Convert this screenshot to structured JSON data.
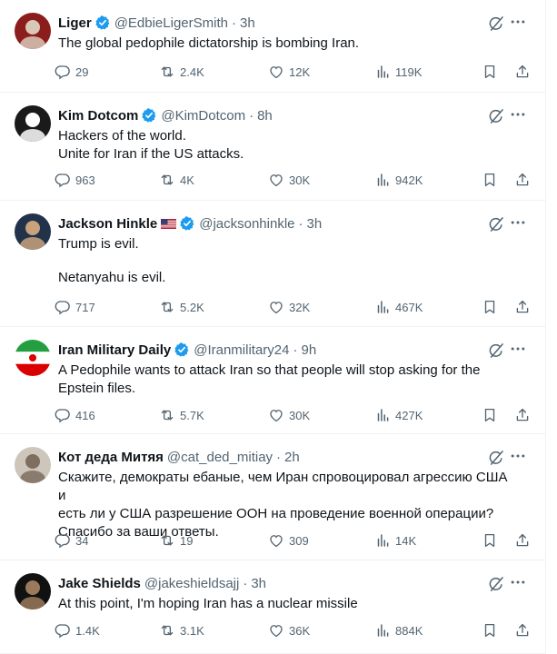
{
  "tweets": [
    {
      "name": "Liger",
      "handle": "@EdbieLigerSmith",
      "time": "3h",
      "verified": true,
      "flag": false,
      "lines": [
        "The global pedophile dictatorship is bombing Iran."
      ],
      "replies": "29",
      "reposts": "2.4K",
      "likes": "12K",
      "views": "119K",
      "avatar_colors": [
        "#8b1d1d",
        "#d9c8b8"
      ]
    },
    {
      "name": "Kim Dotcom",
      "handle": "@KimDotcom",
      "time": "8h",
      "verified": true,
      "flag": false,
      "lines": [
        "Hackers of the world.",
        "Unite for Iran if the US attacks."
      ],
      "replies": "963",
      "reposts": "4K",
      "likes": "30K",
      "views": "942K",
      "avatar_colors": [
        "#1a1a1a",
        "#ffffff"
      ]
    },
    {
      "name": "Jackson Hinkle",
      "handle": "@jacksonhinkle",
      "time": "3h",
      "verified": true,
      "flag": true,
      "lines": [
        "Trump is evil.",
        "",
        "Netanyahu is evil."
      ],
      "replies": "717",
      "reposts": "5.2K",
      "likes": "32K",
      "views": "467K",
      "avatar_colors": [
        "#22324a",
        "#c8a27c"
      ]
    },
    {
      "name": "Iran Military Daily",
      "handle": "@Iranmilitary24",
      "time": "9h",
      "verified": true,
      "flag": false,
      "lines": [
        "A Pedophile wants to attack Iran so that people will stop asking for the",
        "Epstein files."
      ],
      "replies": "416",
      "reposts": "5.7K",
      "likes": "30K",
      "views": "427K",
      "avatar_colors": [
        "#239f40",
        "#da0000"
      ]
    },
    {
      "name": "Кот деда Митяя",
      "handle": "@cat_ded_mitiay",
      "time": "2h",
      "verified": false,
      "flag": false,
      "lines": [
        "Скажите, демократы ебаные, чем Иран спровоцировал агрессию США и",
        "есть ли у США разрешение ООН на проведение военной операции?",
        "Спасибо за ваши ответы."
      ],
      "replies": "34",
      "reposts": "19",
      "likes": "309",
      "views": "14K",
      "avatar_colors": [
        "#cfc6bb",
        "#7d6e60"
      ]
    },
    {
      "name": "Jake Shields",
      "handle": "@jakeshieldsajj",
      "time": "3h",
      "verified": false,
      "flag": false,
      "lines": [
        "At this point, I'm hoping Iran has a nuclear missile"
      ],
      "replies": "1.4K",
      "reposts": "3.1K",
      "likes": "36K",
      "views": "884K",
      "avatar_colors": [
        "#111111",
        "#9b7a5c"
      ]
    }
  ],
  "colors": {
    "text": "#0f1419",
    "muted": "#536471",
    "verified": "#1d9bf0",
    "divider": "#eff3f4"
  },
  "icons": [
    "reply-icon",
    "repost-icon",
    "like-icon",
    "views-icon",
    "bookmark-icon",
    "share-icon",
    "grok-icon",
    "more-icon",
    "verified-badge-icon"
  ]
}
